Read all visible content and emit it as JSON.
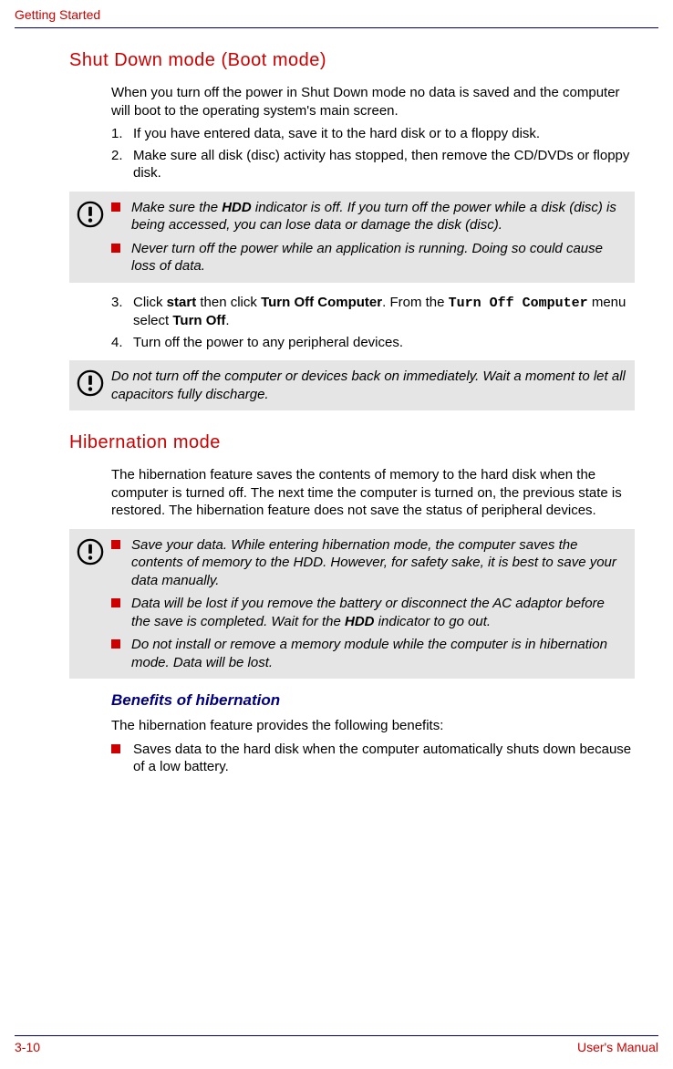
{
  "header": {
    "chapter": "Getting Started"
  },
  "footer": {
    "page": "3-10",
    "manual": "User's Manual"
  },
  "section1": {
    "title": "Shut Down mode (Boot mode)",
    "intro": "When you turn off the power in Shut Down mode no data is saved and the computer will boot to the operating system's main screen.",
    "step1": "If you have entered data, save it to the hard disk or to a floppy disk.",
    "step2": "Make sure all disk (disc) activity has stopped, then remove the CD/DVDs or floppy disk.",
    "warn1_a_pre": "Make sure the ",
    "warn1_a_hdd": "HDD",
    "warn1_a_post": " indicator is off. If you turn off the power while a disk (disc) is being accessed, you can lose data or damage the disk (disc).",
    "warn1_b": "Never turn off the power while an application is running. Doing so could cause loss of data.",
    "step3_pre": "Click ",
    "step3_start": "start",
    "step3_mid1": " then click ",
    "step3_toc": "Turn Off Computer",
    "step3_mid2": ". From the ",
    "step3_mono": "Turn Off Computer",
    "step3_mid3": " menu select ",
    "step3_to": "Turn Off",
    "step3_end": ".",
    "step4": "Turn off the power to any peripheral devices.",
    "warn2": "Do not turn off the computer or devices back on immediately. Wait a moment to let all capacitors fully discharge."
  },
  "section2": {
    "title": "Hibernation mode",
    "intro": "The hibernation feature saves the contents of memory to the hard disk when the computer is turned off. The next time the computer is turned on, the previous state is restored. The hibernation feature does not save the status of peripheral devices.",
    "warn_a": "Save your data. While entering hibernation mode, the computer saves the contents of memory to the HDD. However, for safety sake, it is best to save your data manually.",
    "warn_b_pre": "Data will be lost if you remove the battery or disconnect the AC adaptor before the save is completed. Wait for the ",
    "warn_b_hdd": "HDD",
    "warn_b_post": " indicator to go out.",
    "warn_c": "Do not install or remove a memory module while the computer is in hibernation mode. Data will be lost.",
    "sub": "Benefits of hibernation",
    "benefits_intro": "The hibernation feature provides the following benefits:",
    "benefit1": "Saves data to the hard disk when the computer automatically shuts down because of a low battery."
  }
}
